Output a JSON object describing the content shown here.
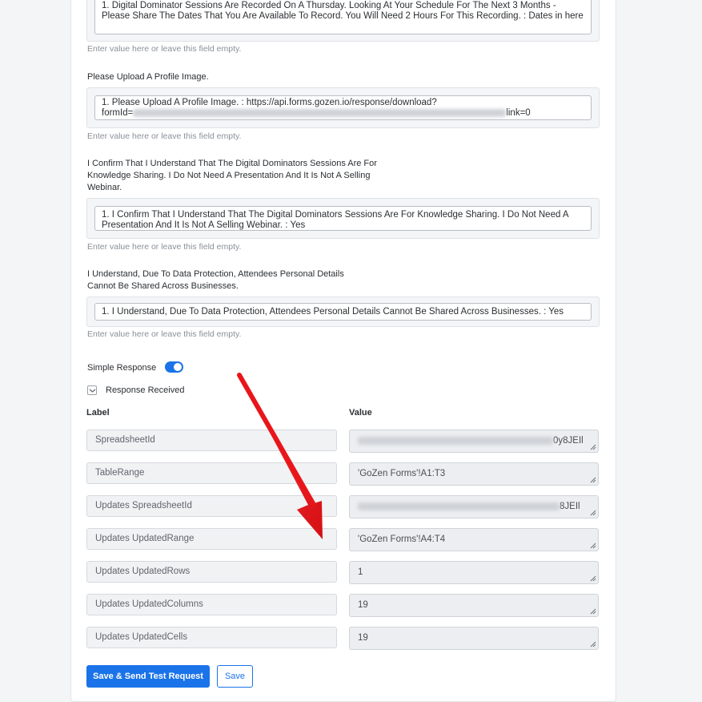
{
  "fields": [
    {
      "value": "1. Digital Dominator Sessions Are Recorded On A Thursday. Looking At Your Schedule For The Next 3 Months - Please Share The Dates That You Are Available To Record. You Will Need 2 Hours For This Recording. : Dates in here",
      "hint": "Enter value here or leave this field empty."
    },
    {
      "label": "Please Upload A Profile Image.",
      "value_line1": "1. Please Upload A Profile Image. : https://api.forms.gozen.io/response/download?",
      "value_prefix": "formId=",
      "value_suffix": "link=0",
      "hint": "Enter value here or leave this field empty."
    },
    {
      "label": "I Confirm That I Understand That The Digital Dominators Sessions Are For Knowledge Sharing. I Do Not Need A Presentation And It Is Not A Selling Webinar.",
      "value": "1. I Confirm That I Understand That The Digital Dominators Sessions Are For Knowledge Sharing. I Do Not Need A Presentation And It Is Not A Selling Webinar. : Yes",
      "hint": "Enter value here or leave this field empty."
    },
    {
      "label": "I Understand, Due To Data Protection, Attendees Personal Details Cannot Be Shared Across Businesses.",
      "value": "1. I Understand, Due To Data Protection, Attendees Personal Details Cannot Be Shared Across Businesses. : Yes",
      "hint": "Enter value here or leave this field empty."
    }
  ],
  "simple_response": {
    "label": "Simple Response",
    "enabled": true
  },
  "response_received": {
    "label": "Response Received"
  },
  "table": {
    "label_header": "Label",
    "value_header": "Value",
    "rows": [
      {
        "label": "SpreadsheetId",
        "value": "0y8JEIl",
        "blurred": true
      },
      {
        "label": "TableRange",
        "value": "'GoZen Forms'!A1:T3",
        "blurred": false
      },
      {
        "label": "Updates SpreadsheetId",
        "value": "8JEIl",
        "blurred": true
      },
      {
        "label": "Updates UpdatedRange",
        "value": "'GoZen Forms'!A4:T4",
        "blurred": false
      },
      {
        "label": "Updates UpdatedRows",
        "value": "1",
        "blurred": false
      },
      {
        "label": "Updates UpdatedColumns",
        "value": "19",
        "blurred": false
      },
      {
        "label": "Updates UpdatedCells",
        "value": "19",
        "blurred": false
      }
    ]
  },
  "buttons": {
    "save_send": "Save & Send Test Request",
    "save": "Save"
  },
  "colors": {
    "accent": "#1a73e8",
    "annotation_arrow": "#e8161b"
  }
}
